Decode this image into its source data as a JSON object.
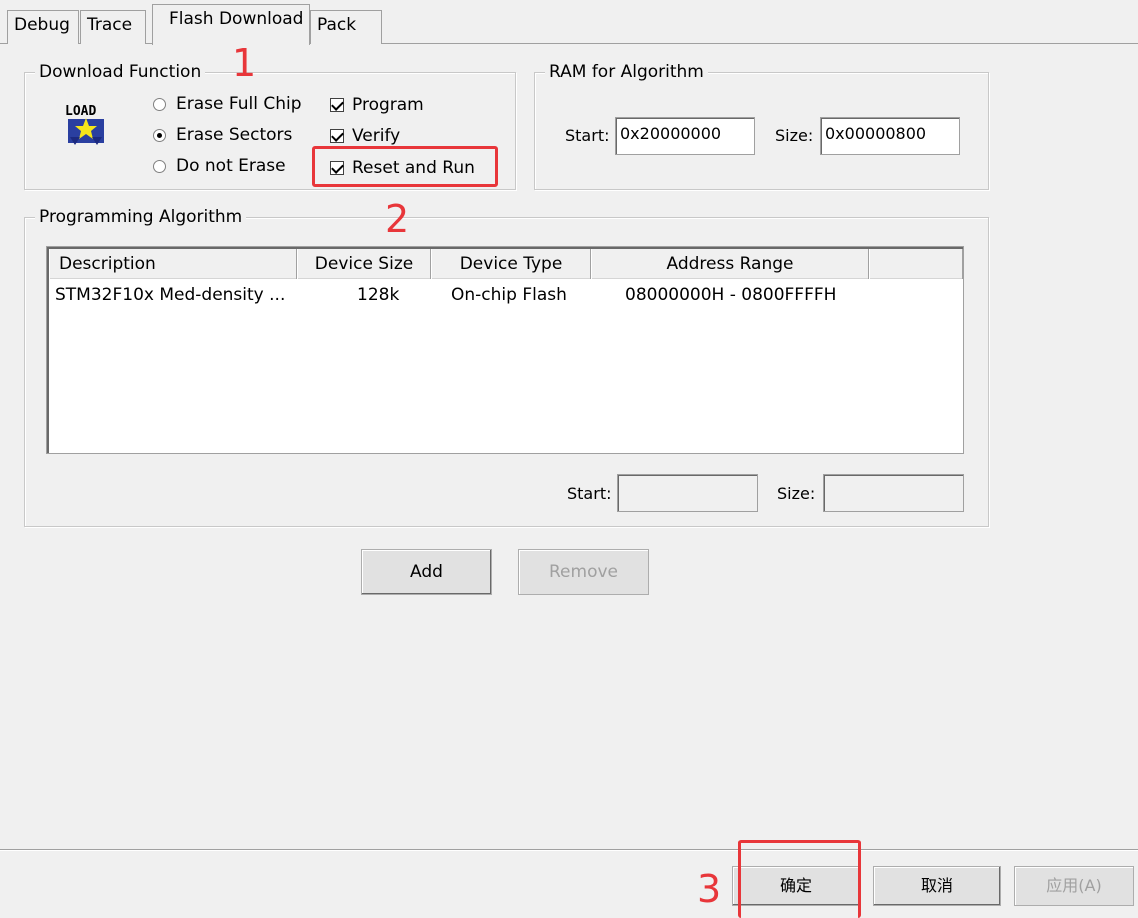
{
  "tabs": [
    {
      "label": "Debug"
    },
    {
      "label": "Trace"
    },
    {
      "label": "Flash Download"
    },
    {
      "label": "Pack"
    }
  ],
  "download_function": {
    "title": "Download Function",
    "icon": "load-icon",
    "radios": [
      {
        "label": "Erase Full Chip",
        "selected": false
      },
      {
        "label": "Erase Sectors",
        "selected": true
      },
      {
        "label": "Do not Erase",
        "selected": false
      }
    ],
    "checks": [
      {
        "label": "Program",
        "checked": true
      },
      {
        "label": "Verify",
        "checked": true
      },
      {
        "label": "Reset and Run",
        "checked": true
      }
    ]
  },
  "ram": {
    "title": "RAM for Algorithm",
    "start_label": "Start:",
    "start_value": "0x20000000",
    "size_label": "Size:",
    "size_value": "0x00000800"
  },
  "algorithm": {
    "title": "Programming Algorithm",
    "columns": [
      "Description",
      "Device Size",
      "Device Type",
      "Address Range"
    ],
    "rows": [
      {
        "description": "STM32F10x Med-density ...",
        "size": "128k",
        "type": "On-chip Flash",
        "range": "08000000H - 0800FFFFH"
      }
    ],
    "start_label": "Start:",
    "size_label": "Size:"
  },
  "buttons": {
    "add": "Add",
    "remove": "Remove",
    "ok": "确定",
    "cancel": "取消",
    "apply": "应用(A)"
  },
  "annotations": {
    "one": "1",
    "two": "2",
    "three": "3",
    "color": "#e8363a"
  }
}
